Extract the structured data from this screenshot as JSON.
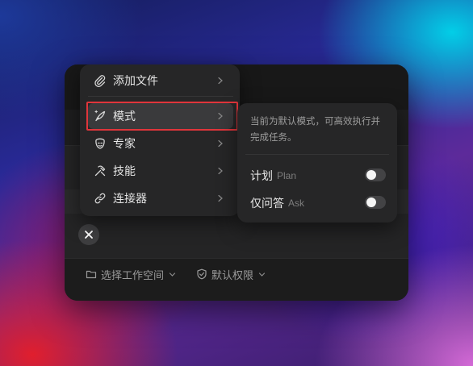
{
  "menu": {
    "items": [
      {
        "label": "添加文件",
        "icon": "paperclip-icon"
      },
      {
        "label": "模式",
        "icon": "quill-icon"
      },
      {
        "label": "专家",
        "icon": "expert-icon"
      },
      {
        "label": "技能",
        "icon": "tools-icon"
      },
      {
        "label": "连接器",
        "icon": "link-icon"
      }
    ]
  },
  "submenu": {
    "description": "当前为默认模式，可高效执行并完成任务。",
    "options": [
      {
        "label": "计划",
        "sub": "Plan",
        "enabled": false
      },
      {
        "label": "仅问答",
        "sub": "Ask",
        "enabled": false
      }
    ]
  },
  "footer": {
    "workspace_label": "选择工作空间",
    "permission_label": "默认权限"
  },
  "colors": {
    "highlight": "#e0353b",
    "window_bg": "#1e1e1f",
    "menu_bg": "#262627"
  }
}
